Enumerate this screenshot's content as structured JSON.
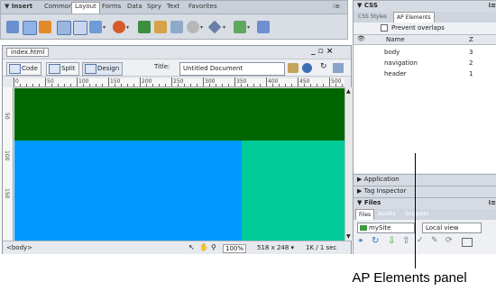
{
  "insert_bar": {
    "title": "▼ Insert",
    "tabs": [
      "Common",
      "Layout",
      "Forms",
      "Data",
      "Spry",
      "Text",
      "Favorites"
    ],
    "active_tab": "Layout",
    "menu_glyph": "⁝≡"
  },
  "document": {
    "filename": "index.html",
    "window_controls": "_ ▫ ×",
    "code_label": "Code",
    "split_label": "Split",
    "design_label": "Design",
    "title_label": "Title:",
    "title_value": "Untitled Document",
    "ruler_numbers": [
      "0",
      "50",
      "100",
      "150",
      "200",
      "250",
      "300",
      "350",
      "400",
      "450",
      "500"
    ],
    "ruler_left_numbers": [
      "50",
      "100",
      "150"
    ],
    "status": {
      "tag": "<body>",
      "zoom": "100%",
      "dimensions": "518 x 248 ▾",
      "size": "1K / 1 sec"
    },
    "canvas_colors": {
      "header": "#006600",
      "navigation": "#0099ff",
      "body": "#00cc99"
    }
  },
  "panels": {
    "css_title": "▼ CSS",
    "panel_menu_glyph": "⁝≡",
    "css_tabs": [
      "CSS Styles",
      "AP Elements"
    ],
    "prevent_overlaps": "Prevent overlaps",
    "columns": {
      "visibility": "👁",
      "name": "Name",
      "z": "Z"
    },
    "ap_elements": [
      {
        "name": "body",
        "z": "3"
      },
      {
        "name": "navigation",
        "z": "2"
      },
      {
        "name": "header",
        "z": "1"
      }
    ],
    "application": "▶ Application",
    "tag_inspector": "▶ Tag Inspector",
    "files_title": "▼ Files",
    "files_tabs": [
      "Files",
      "Assets",
      "Snippets"
    ],
    "site_select": "mySite",
    "view_select": "Local view"
  },
  "callout": "AP Elements panel"
}
